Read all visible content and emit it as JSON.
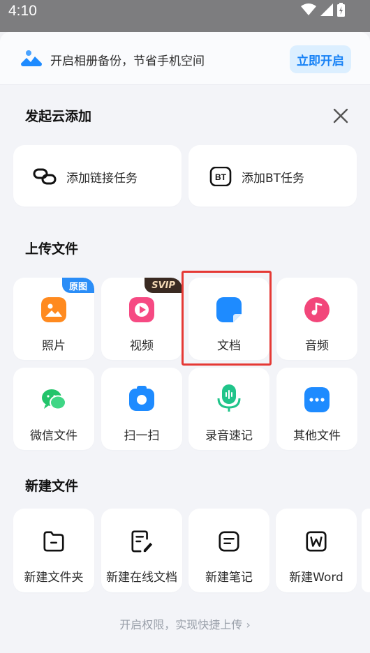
{
  "status_bar": {
    "time": "4:10"
  },
  "banner": {
    "text": "开启相册备份，节省手机空间",
    "button": "立即开启"
  },
  "cloud_add": {
    "title": "发起云添加",
    "items": [
      {
        "label": "添加链接任务",
        "icon": "link-icon"
      },
      {
        "label": "添加BT任务",
        "icon": "bt-icon"
      }
    ]
  },
  "upload": {
    "title": "上传文件",
    "items": [
      {
        "label": "照片",
        "icon": "photo-icon",
        "color": "#ff8a1f",
        "badge": "原图",
        "badge_color": "#2a8df7"
      },
      {
        "label": "视频",
        "icon": "video-icon",
        "color": "#f64a83",
        "badge": "SVIP",
        "badge_color": "#3a2a22"
      },
      {
        "label": "文档",
        "icon": "document-icon",
        "color": "#1e8bff"
      },
      {
        "label": "音频",
        "icon": "audio-icon",
        "color": "#f2467a"
      },
      {
        "label": "微信文件",
        "icon": "wechat-icon",
        "color": "#22c46a"
      },
      {
        "label": "扫一扫",
        "icon": "scan-icon",
        "color": "#1e8bff"
      },
      {
        "label": "录音速记",
        "icon": "microphone-icon",
        "color": "#20c48a"
      },
      {
        "label": "其他文件",
        "icon": "more-icon",
        "color": "#1e8bff"
      }
    ]
  },
  "new_file": {
    "title": "新建文件",
    "items": [
      {
        "label": "新建文件夹",
        "icon": "folder-icon"
      },
      {
        "label": "新建在线文档",
        "icon": "online-doc-icon"
      },
      {
        "label": "新建笔记",
        "icon": "note-icon"
      },
      {
        "label": "新建Word",
        "icon": "word-icon"
      }
    ]
  },
  "footer": {
    "text": "开启权限，实现快捷上传 ›"
  },
  "colors": {
    "accent": "#1681f6",
    "highlight": "#e53935"
  }
}
